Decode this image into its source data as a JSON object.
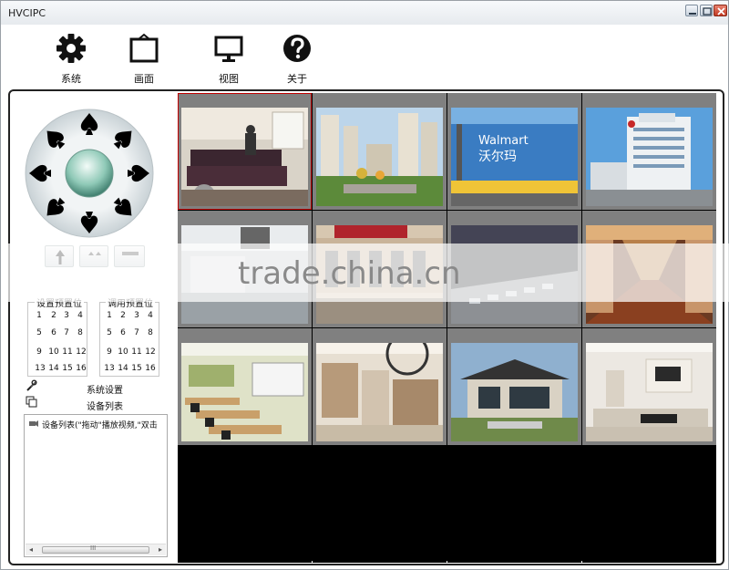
{
  "window": {
    "title": "HVCIPC"
  },
  "toolbar": {
    "items": [
      {
        "label": "系统",
        "icon": "gear-icon"
      },
      {
        "label": "画面",
        "icon": "picture-frame-icon"
      },
      {
        "label": "视图",
        "icon": "monitor-icon"
      },
      {
        "label": "关于",
        "icon": "question-icon"
      }
    ]
  },
  "presets": {
    "set_title": "设置预置位",
    "call_title": "调用预置位",
    "numbers": [
      "1",
      "2",
      "3",
      "4",
      "5",
      "6",
      "7",
      "8",
      "9",
      "10",
      "11",
      "12",
      "13",
      "14",
      "15",
      "16"
    ]
  },
  "sidebar": {
    "system_settings": "系统设置",
    "device_list": "设备列表"
  },
  "device_tree": {
    "root_label": "设备列表(\"拖动\"播放视频,\"双击",
    "scrollbar_grip": "III"
  },
  "watermark": {
    "text": "trade.china.cn"
  },
  "video_grid": {
    "rows": 4,
    "cols": 4,
    "active_index": 0,
    "scenes": [
      "living-room",
      "residential-towers",
      "walmart-store",
      "hospital-building",
      "office-interior",
      "street-storefronts",
      "road-night",
      "hotel-corridor",
      "classroom",
      "shop-interior",
      "modern-house",
      "white-living-room",
      "empty",
      "empty",
      "empty",
      "empty"
    ]
  },
  "colors": {
    "grid_cell_gray": "#808080",
    "active_border": "#c00000",
    "window_border": "#222222"
  }
}
